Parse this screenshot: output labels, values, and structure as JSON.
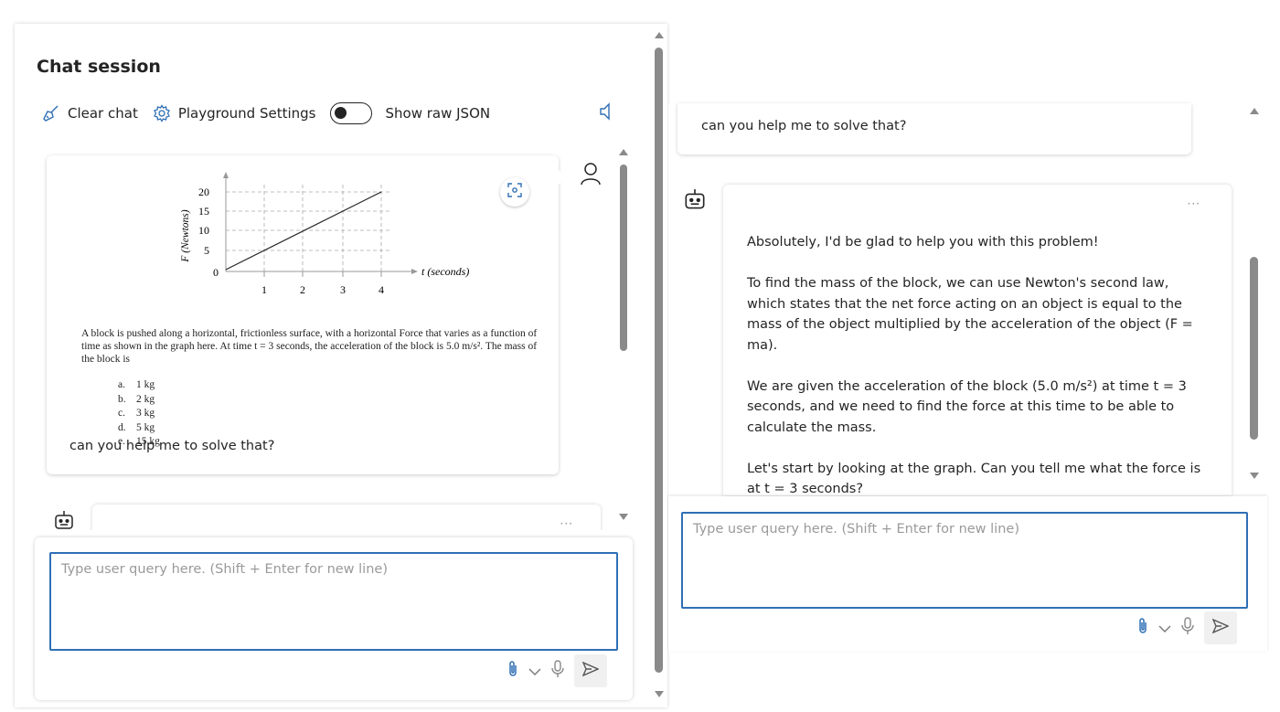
{
  "left": {
    "title": "Chat session",
    "toolbar": {
      "clear_chat": "Clear chat",
      "playground_settings": "Playground Settings",
      "show_raw_json": "Show raw JSON"
    },
    "problem": {
      "ylabel": "F (Newtons)",
      "xlabel": "t (seconds)",
      "yticks": [
        "20",
        "15",
        "10",
        "5",
        "0"
      ],
      "xticks": [
        "1",
        "2",
        "3",
        "4"
      ],
      "text": "A block is pushed along a horizontal, frictionless surface, with a horizontal Force that varies as a function of time as shown in the graph here. At time t = 3 seconds, the acceleration of the block is 5.0 m/s². The mass of the block is",
      "options": [
        {
          "letter": "a.",
          "value": "1 kg"
        },
        {
          "letter": "b.",
          "value": "2 kg"
        },
        {
          "letter": "c.",
          "value": "3 kg"
        },
        {
          "letter": "d.",
          "value": "5 kg"
        },
        {
          "letter": "e.",
          "value": "15 kg"
        }
      ]
    },
    "user_query": "can you help me to solve that?",
    "bot_dots": "···",
    "input_placeholder": "Type user query here. (Shift + Enter for new line)"
  },
  "right": {
    "user_query": "can you help me to solve that?",
    "bot_dots": "···",
    "reply": [
      "Absolutely, I'd be glad to help you with this problem!",
      "To find the mass of the block, we can use Newton's second law, which states that the net force acting on an object is equal to the mass of the object multiplied by the acceleration of the object (F = ma).",
      "We are given the acceleration of the block (5.0 m/s²) at time t = 3 seconds, and we need to find the force at this time to be able to calculate the mass.",
      "Let's start by looking at the graph. Can you tell me what the force is at t = 3 seconds?"
    ],
    "input_placeholder": "Type user query here. (Shift + Enter for new line)"
  },
  "icons": {
    "clear_chat": "broom-icon",
    "settings": "gear-icon",
    "speaker": "speaker-icon",
    "user": "person-icon",
    "bot": "bot-icon",
    "scan": "scan-icon",
    "attach": "paperclip-icon",
    "chevron": "chevron-down-icon",
    "mic": "microphone-icon",
    "send": "send-icon"
  },
  "colors": {
    "input_border": "#2f6fb5",
    "scrollbar": "#8a8a8a"
  }
}
